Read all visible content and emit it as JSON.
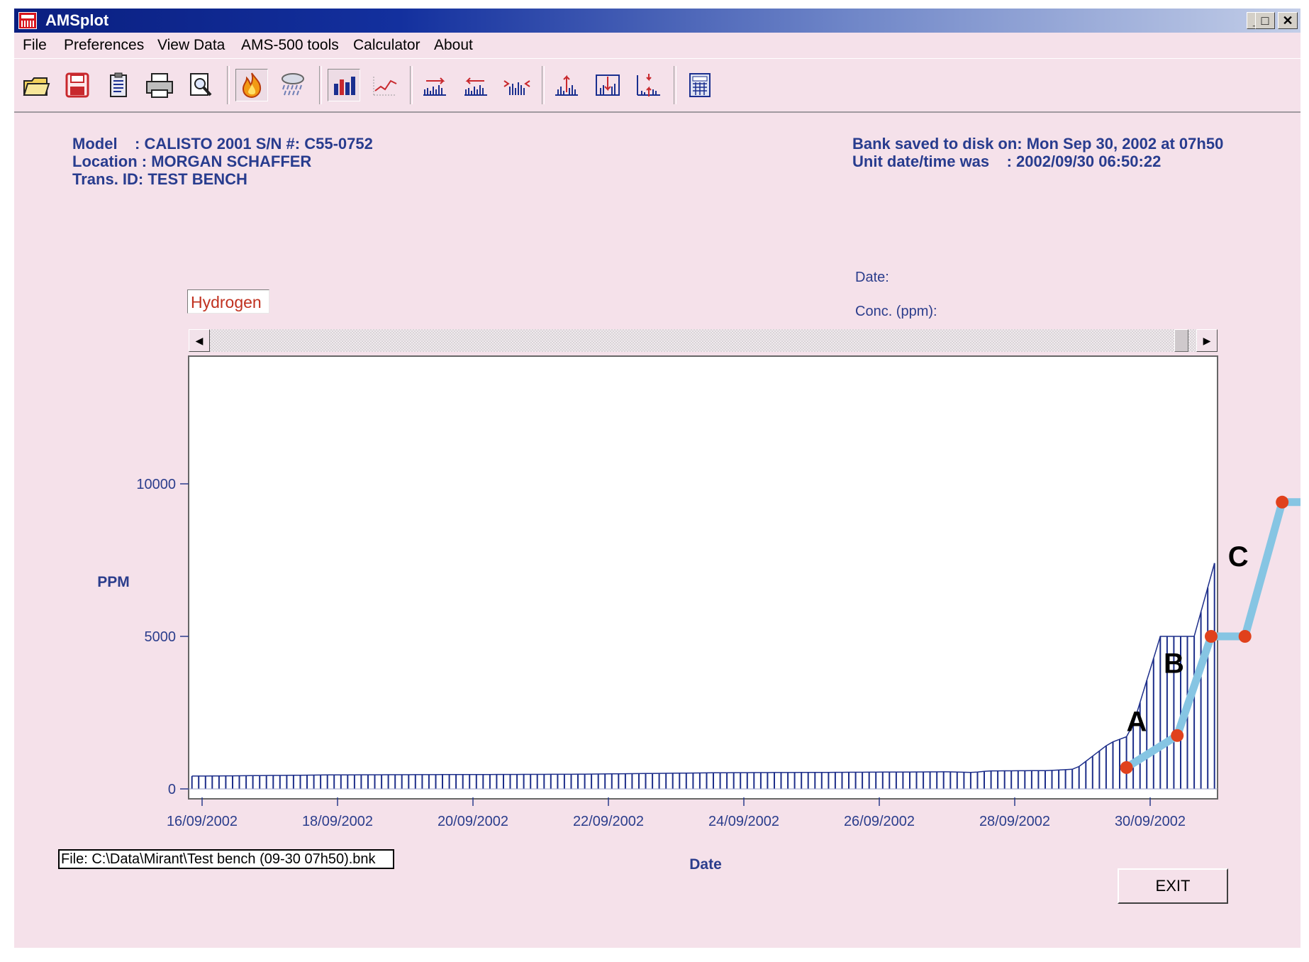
{
  "window": {
    "title": "AMSplot",
    "controls": {
      "minimize": "_",
      "maximize": "□",
      "close": "✕"
    }
  },
  "menu": [
    "File",
    "Preferences",
    "View Data",
    "AMS-500 tools",
    "Calculator",
    "About"
  ],
  "toolbar": {
    "icons": [
      "open-folder-icon",
      "save-disk-icon",
      "clipboard-icon",
      "print-icon",
      "print-preview-icon",
      "fire-icon",
      "rain-icon",
      "bar-chart-icon",
      "line-chart-icon",
      "scroll-right-icon",
      "scroll-left-icon",
      "expand-horizontal-icon",
      "zoom-in-vertical-icon",
      "zoom-out-vertical-icon",
      "fit-vertical-icon",
      "calculator-icon"
    ]
  },
  "header": {
    "model_line": "Model    : CALISTO 2001 S/N #: C55-0752",
    "location_line": "Location : MORGAN SCHAFFER",
    "trans_line": "Trans. ID: TEST BENCH",
    "saved_line": "Bank saved to disk on: Mon Sep 30, 2002 at 07h50",
    "unit_line": "Unit date/time was    : 2002/09/30 06:50:22"
  },
  "readout": {
    "date_label": "Date:",
    "conc_label": "Conc. (ppm):"
  },
  "gas_name": "Hydrogen",
  "footer": {
    "file_label": "File: C:\\Data\\Mirant\\Test bench (09-30 07h50).bnk",
    "exit_label": "EXIT"
  },
  "colors": {
    "bars": "#1d2e8a",
    "trend": "#86c5e3",
    "markers": "#e0411c",
    "labels": "#2b3d8c",
    "window_bg": "#f5e1ea"
  },
  "chart_data": {
    "type": "bar",
    "xlabel": "Date",
    "ylabel": "PPM",
    "x_ticks": [
      "16/09/2002",
      "18/09/2002",
      "20/09/2002",
      "22/09/2002",
      "24/09/2002",
      "26/09/2002",
      "28/09/2002",
      "30/09/2002"
    ],
    "y_ticks": [
      0,
      5000,
      10000
    ],
    "ylim": [
      0,
      14000
    ],
    "x_range_days": [
      -0.25,
      14.7
    ],
    "series": [
      {
        "values": [
          {
            "day": 0,
            "ppm": 420
          },
          {
            "day": 2,
            "ppm": 460
          },
          {
            "day": 5.5,
            "ppm": 480
          },
          {
            "day": 7.6,
            "ppm": 530
          },
          {
            "day": 9,
            "ppm": 540
          },
          {
            "day": 11,
            "ppm": 560
          },
          {
            "day": 11.4,
            "ppm": 540
          },
          {
            "day": 11.6,
            "ppm": 590
          },
          {
            "day": 12.5,
            "ppm": 600
          },
          {
            "day": 12.9,
            "ppm": 650
          },
          {
            "day": 13.4,
            "ppm": 1500
          },
          {
            "day": 13.7,
            "ppm": 1750
          },
          {
            "day": 14.15,
            "ppm": 5000
          },
          {
            "day": 14.65,
            "ppm": 5000
          },
          {
            "day": 15.2,
            "ppm": 9400
          },
          {
            "day": 15.6,
            "ppm": 9400
          }
        ]
      }
    ],
    "trend_points": [
      {
        "day": 13.65,
        "ppm": 700
      },
      {
        "day": 14.4,
        "ppm": 1750
      },
      {
        "day": 14.9,
        "ppm": 5000
      },
      {
        "day": 15.4,
        "ppm": 5000
      },
      {
        "day": 15.95,
        "ppm": 9400
      },
      {
        "day": 16.45,
        "ppm": 9400
      }
    ],
    "annotations": [
      {
        "text": "A",
        "day": 13.8,
        "ppm": 1900
      },
      {
        "text": "B",
        "day": 14.35,
        "ppm": 3800
      },
      {
        "text": "C",
        "day": 15.3,
        "ppm": 7300
      }
    ]
  }
}
